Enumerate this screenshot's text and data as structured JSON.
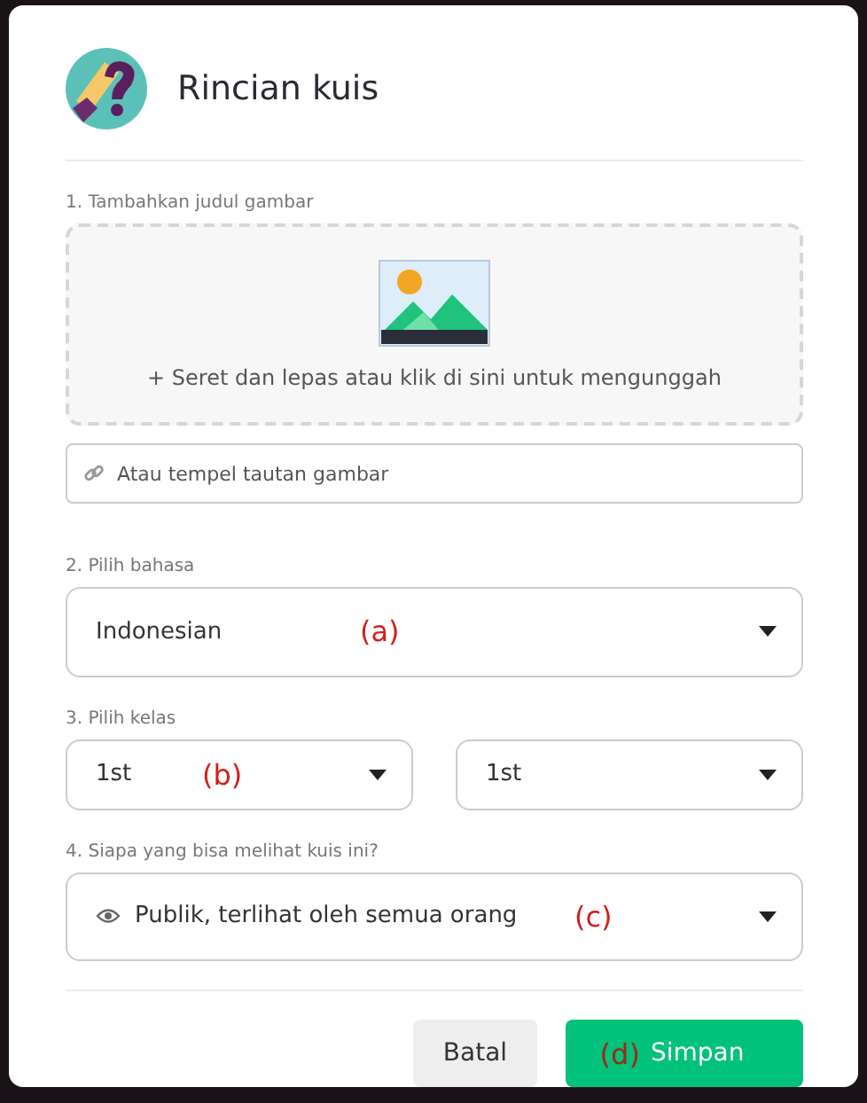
{
  "dialog": {
    "title": "Rincian kuis"
  },
  "image_section": {
    "label": "1. Tambahkan judul gambar",
    "plus": "+",
    "upload_hint": "Seret dan lepas atau klik di sini untuk mengunggah",
    "link_field": {
      "placeholder": "Atau tempel tautan gambar"
    }
  },
  "language": {
    "label": "2. Pilih bahasa",
    "value": "Indonesian",
    "annotation": "(a)"
  },
  "grade": {
    "label": "3. Pilih kelas",
    "selects": [
      {
        "value": "1st",
        "annotation": "(b)"
      },
      {
        "value": "1st"
      }
    ]
  },
  "visibility": {
    "label": "4. Siapa yang bisa melihat kuis ini?",
    "value": "Publik, terlihat oleh semua orang",
    "annotation": "(c)"
  },
  "buttons": [
    {
      "kind": "secondary",
      "label": "Batal"
    },
    {
      "kind": "primary",
      "label": "Simpan",
      "annotation": "(d)"
    }
  ]
}
